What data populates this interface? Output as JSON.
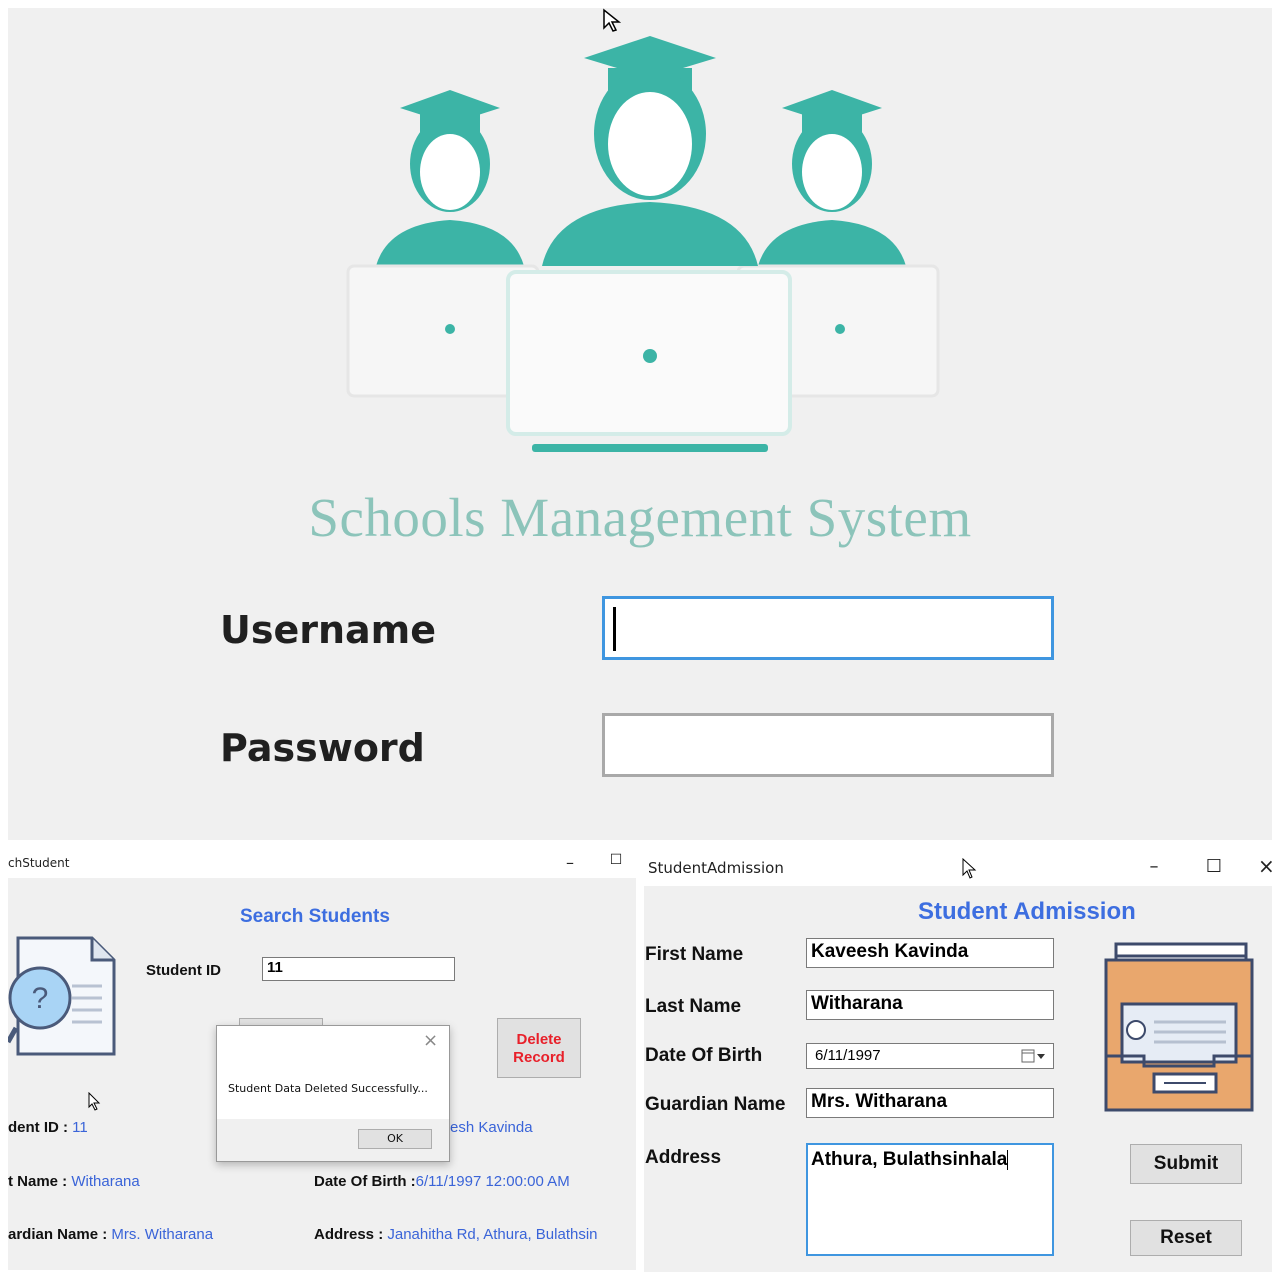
{
  "login": {
    "title": "Schools Management System",
    "username_label": "Username",
    "password_label": "Password",
    "username_value": "",
    "password_value": ""
  },
  "search_window": {
    "title": "chStudent",
    "heading": "Search Students",
    "student_id_label": "Student ID",
    "student_id_value": "11",
    "delete_button": "Delete\nRecord",
    "result": {
      "id_label": "dent ID :",
      "id_value": "11",
      "name_value_partial": "esh Kavinda",
      "last_name_label": "t Name :",
      "last_name_value": "Witharana",
      "dob_label": "Date Of Birth :",
      "dob_value": "6/11/1997 12:00:00 AM",
      "guardian_label": "ardian Name :",
      "guardian_value": "Mrs. Witharana",
      "address_label": "Address :",
      "address_value": "Janahitha Rd, Athura, Bulathsin"
    },
    "message_box": {
      "text": "Student Data Deleted Successfully...",
      "ok": "OK"
    }
  },
  "admission_window": {
    "title": "StudentAdmission",
    "heading": "Student Admission",
    "fields": {
      "first_name_label": "First Name",
      "first_name_value": "Kaveesh Kavinda",
      "last_name_label": "Last Name",
      "last_name_value": "Witharana",
      "dob_label": "Date Of Birth",
      "dob_value": "6/11/1997",
      "guardian_label": "Guardian Name",
      "guardian_value": "Mrs. Witharana",
      "address_label": "Address",
      "address_value": "Athura, Bulathsinhala"
    },
    "submit": "Submit",
    "reset": "Reset"
  },
  "icons": {
    "minimize": "–",
    "maximize": "☐",
    "close": "×"
  },
  "colors": {
    "teal": "#3cb4a6",
    "heading_blue": "#3d6ee0",
    "delete_red": "#e8202a"
  }
}
